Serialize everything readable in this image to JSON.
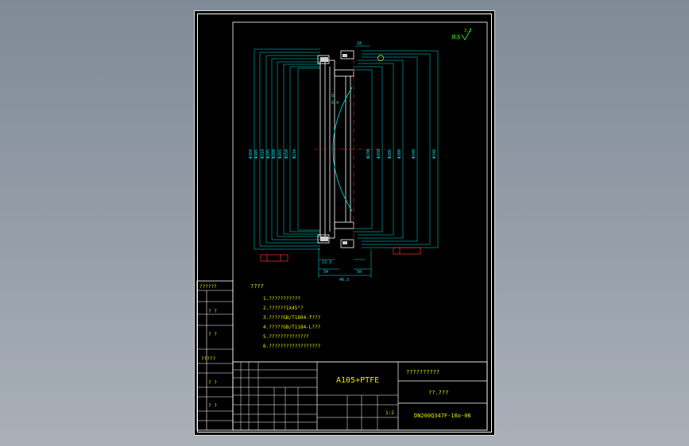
{
  "drawing": {
    "roughness_note": "其余",
    "roughness_value": "3.2",
    "tech_title": "????",
    "tech_notes": [
      "1.???????????",
      "2.??????1X45°?",
      "3.?????GB/T1804-f???",
      "4.?????GB/T1184-L???",
      "5.??????????????",
      "6.??????????????????"
    ],
    "side_table": [
      "??????",
      "?  ?",
      "?  ?",
      "?????",
      "?  ?",
      "?  ?"
    ],
    "material": "A105+PTFE",
    "company": "??????????",
    "part_name": "??.???",
    "drawing_number": "DN200Q347F-16o-06",
    "scale": "1:2",
    "dimensions": {
      "left": [
        "Φ360",
        "Φ345",
        "Φ310",
        "Φ295",
        "Φ280",
        "Φ265",
        "Φ250",
        "Φ234"
      ],
      "right": [
        "Φ230",
        "Φ260",
        "Φ285",
        "Φ300",
        "Φ340",
        "Φ348"
      ],
      "bottom": [
        "46.3",
        "34",
        "50",
        "13.3"
      ],
      "top": [
        "18",
        "8",
        "6.4"
      ]
    }
  }
}
